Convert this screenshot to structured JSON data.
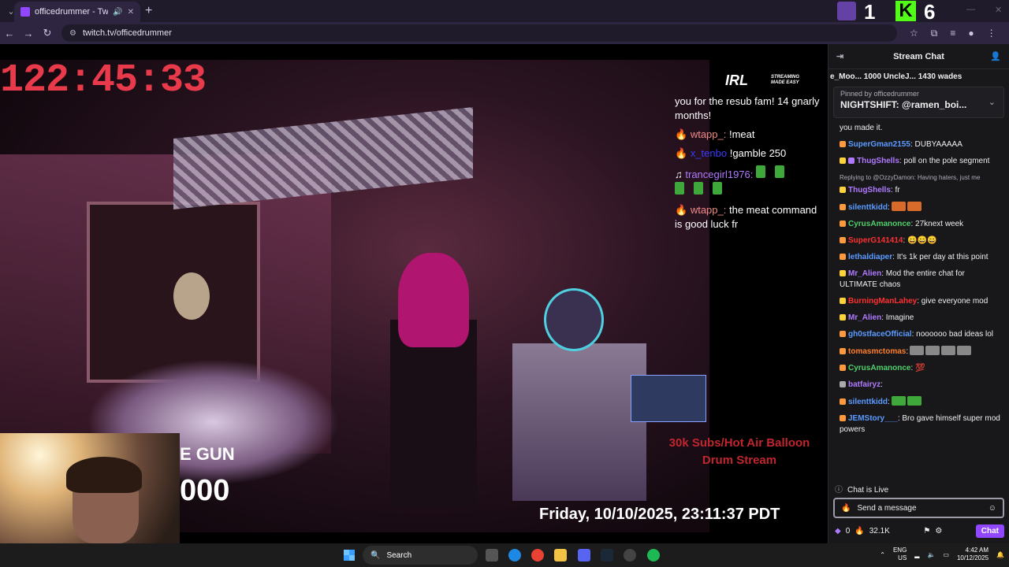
{
  "browser": {
    "tab_title": "officedrummer - Twitch",
    "url": "twitch.tv/officedrummer",
    "overlay_1": "1",
    "overlay_6": "6"
  },
  "video": {
    "timer": "122:45:33",
    "irl_logo": "IRL",
    "irl_tag": "STREAMING MADE EASY",
    "overlay_chat": [
      {
        "user": "",
        "text": "you for the resub fam! 14 gnarly months!"
      },
      {
        "user": "wtapp_:",
        "text": "!meat"
      },
      {
        "user": "",
        "text": "!gamble 250"
      },
      {
        "user": "trancegirl1976:",
        "text": ""
      },
      {
        "user": "wtapp_:",
        "text": "the meat command is good luck fr"
      }
    ],
    "goal_text": "30k Subs/Hot Air Balloon Drum Stream",
    "datetime": "Friday, 10/10/2025, 23:11:37 PDT",
    "gun_text": "E GUN",
    "big_number": "000"
  },
  "chat": {
    "title": "Stream Chat",
    "leaderboard": "e_Moo... 1000 UncleJ... 1430 wades",
    "pinned_by": "Pinned by officedrummer",
    "pinned_msg": "NIGHTSHIFT: @ramen_boi...",
    "messages": [
      {
        "user": "",
        "color": "#efeff1",
        "text": "you made it."
      },
      {
        "user": "SuperGman2155",
        "color": "#5b9bff",
        "text": ": DUBYAAAAA"
      },
      {
        "user": "ThugShells",
        "color": "#b07aff",
        "text": ": poll on the pole segment"
      },
      {
        "user": "ThugShells",
        "color": "#b07aff",
        "text": ": fr",
        "reply": "Replying to @OzzyDamon: Having haters, just me"
      },
      {
        "user": "silenttkidd",
        "color": "#5b9bff",
        "text": ":"
      },
      {
        "user": "CyrusAmanonce",
        "color": "#4fd06a",
        "text": ": 27knext week"
      },
      {
        "user": "SuperG141414",
        "color": "#ff3030",
        "text": ":"
      },
      {
        "user": "lethaldiaper",
        "color": "#5b9bff",
        "text": ": It's 1k per day at this point"
      },
      {
        "user": "Mr_Alien",
        "color": "#b07aff",
        "text": ": Mod the entire chat for ULTIMATE chaos"
      },
      {
        "user": "BurningManLahey",
        "color": "#ff3030",
        "text": ": give everyone mod"
      },
      {
        "user": "Mr_Alien",
        "color": "#b07aff",
        "text": ": Imagine"
      },
      {
        "user": "gh0stfaceOfficial",
        "color": "#5b9bff",
        "text": ": noooooo bad ideas lol"
      },
      {
        "user": "tomasmctomas",
        "color": "#ff7f2a",
        "text": ":"
      },
      {
        "user": "CyrusAmanonce",
        "color": "#4fd06a",
        "text": ":"
      },
      {
        "user": "batfairyz",
        "color": "#b07aff",
        "text": ":"
      },
      {
        "user": "silenttkidd",
        "color": "#5b9bff",
        "text": ":"
      },
      {
        "user": "JEMStory___",
        "color": "#5b9bff",
        "text": ": Bro gave himself super mod powers"
      }
    ],
    "live_label": "Chat is Live",
    "input_placeholder": "Send a message",
    "points": "0",
    "bits": "32.1K",
    "chat_button": "Chat"
  },
  "taskbar": {
    "search": "Search",
    "lang_top": "ENG",
    "lang_bottom": "US",
    "time": "4:42 AM",
    "date": "10/12/2025"
  }
}
